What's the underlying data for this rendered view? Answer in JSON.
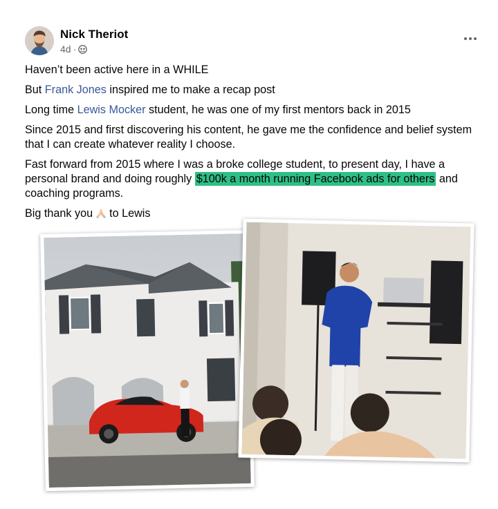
{
  "post": {
    "author": "Nick Theriot",
    "time": "4d",
    "separator": "·",
    "privacy_icon": "group-globe-icon",
    "more_icon": "more-options-icon"
  },
  "body": {
    "p1": "Haven’t been active here in a WHILE",
    "p2_pre": "But ",
    "p2_mention": "Frank Jones",
    "p2_post": " inspired me to make a recap post",
    "p3_pre": "Long time ",
    "p3_mention": "Lewis Mocker",
    "p3_post": " student, he was one of my first mentors back in 2015",
    "p4": "Since 2015 and first discovering his content, he gave me the confidence and belief system that I can create whatever reality I choose.",
    "p5_pre": "Fast forward from 2015 where I was a broke college student, to present day, I have a personal brand and doing roughly ",
    "p5_highlight": "$100k a month running Facebook ads for others",
    "p5_post": " and coaching programs.",
    "p6_pre": "Big thank you",
    "p6_emoji": "praying-hands-emoji",
    "p6_post": "to Lewis"
  },
  "photos": [
    {
      "subject": "white house with red sports car and man standing"
    },
    {
      "subject": "man in blue shirt speaking to seated audience in a room"
    }
  ],
  "colors": {
    "mention": "#385898",
    "highlight": "#2fbf86",
    "meta": "#65676b"
  }
}
